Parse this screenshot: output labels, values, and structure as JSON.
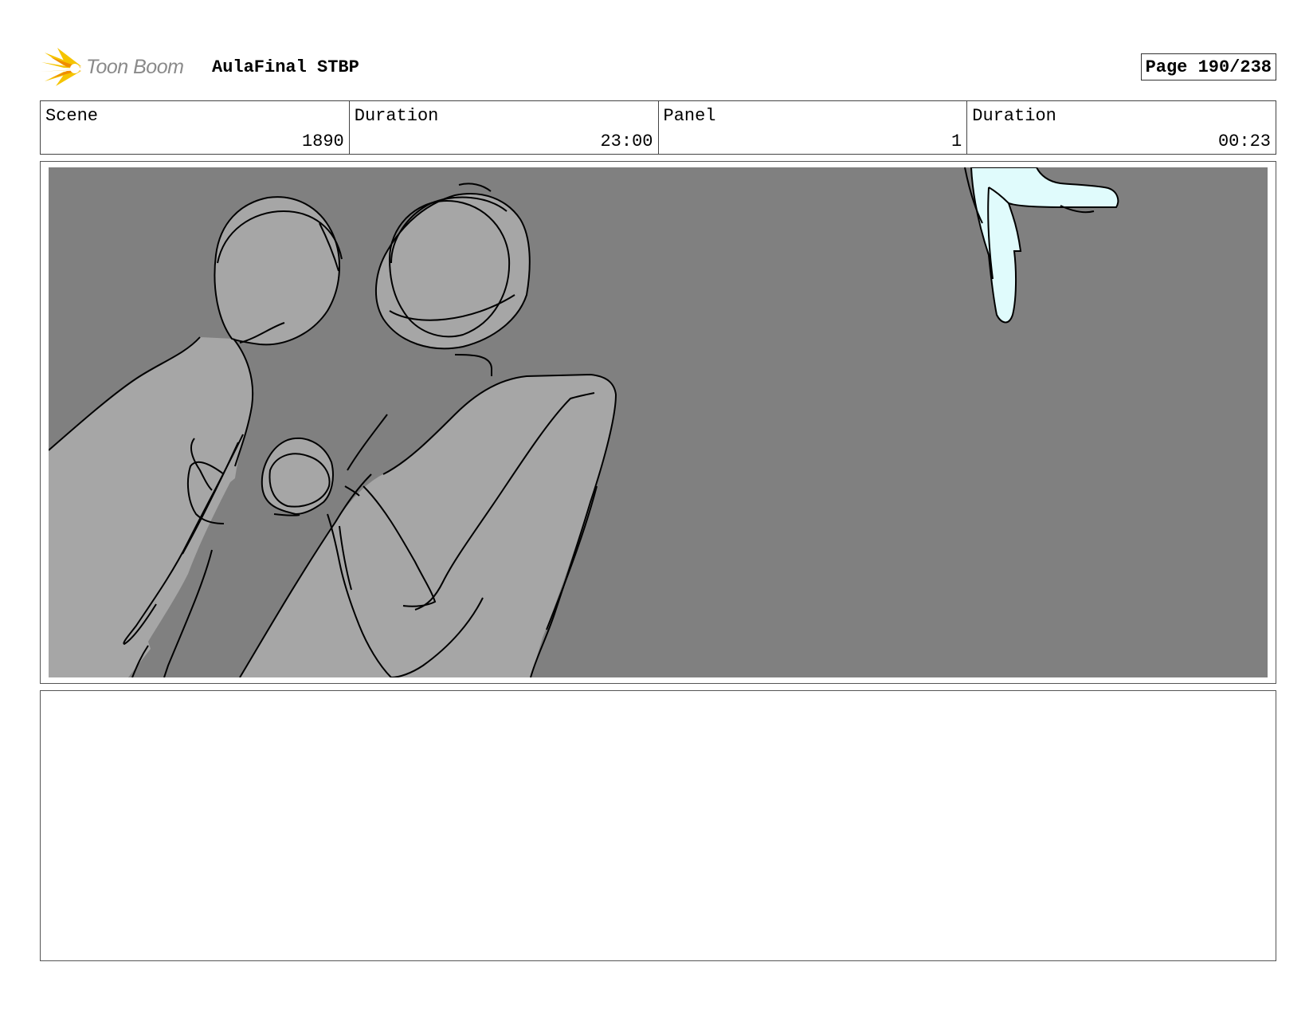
{
  "header": {
    "logo_text": "Toon Boom",
    "project_title": "AulaFinal STBP",
    "page_indicator": "Page 190/238"
  },
  "info": {
    "scene_label": "Scene",
    "scene_value": "1890",
    "scene_duration_label": "Duration",
    "scene_duration_value": "23:00",
    "panel_label": "Panel",
    "panel_value": "1",
    "panel_duration_label": "Duration",
    "panel_duration_value": "00:23"
  },
  "colors": {
    "logo_accent": "#f5c400",
    "panel_background": "#808080",
    "figure_fill": "#a6a6a6",
    "highlight_fill": "#e0fbfc"
  },
  "notes": {
    "text": ""
  }
}
